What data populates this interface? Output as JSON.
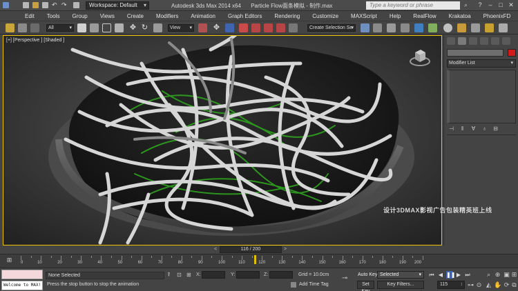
{
  "titlebar": {
    "workspace": "Workspace: Default",
    "app_title": "Autodesk 3ds Max  2014 x64",
    "file_title": "Particle Flow面条模拟 - 制作.max",
    "search_placeholder": "Type a keyword or phrase"
  },
  "menu": [
    "Edit",
    "Tools",
    "Group",
    "Views",
    "Create",
    "Modifiers",
    "Animation",
    "Graph Editors",
    "Rendering",
    "Customize",
    "MAXScript",
    "Help",
    "RealFlow",
    "Krakatoa",
    "PhoenixFD"
  ],
  "toolbar": {
    "filter_value": "All",
    "ref_coord_value": "View",
    "selection_set_value": "Create Selection Se"
  },
  "viewport": {
    "label": "[+] [Perspective ] [Shaded ]"
  },
  "command_panel": {
    "modifier_list": "Modifier List"
  },
  "timeline": {
    "slider_label": "116 / 200",
    "current_frame": 116,
    "total_frames": 200,
    "ruler_labels": [
      "0",
      "10",
      "20",
      "30",
      "40",
      "50",
      "60",
      "70",
      "80",
      "90",
      "100",
      "110",
      "120",
      "130",
      "140",
      "150",
      "160",
      "170",
      "180",
      "190",
      "200"
    ]
  },
  "status": {
    "listener_text": "Welcome to MAX!",
    "selection_status": "None Selected",
    "prompt": "Press the stop button to stop the animation",
    "x_label": "X:",
    "y_label": "Y:",
    "z_label": "Z:",
    "grid": "Grid = 10.0cm",
    "add_time_tag": "Add Time Tag",
    "auto_key": "Auto Key",
    "set_key": "Set Key",
    "selected_option": "Selected",
    "key_filters": "Key Filters...",
    "frame_value": "115"
  },
  "overlay": {
    "watermark": "设计3DMAX影视广告包装精英班上线"
  }
}
